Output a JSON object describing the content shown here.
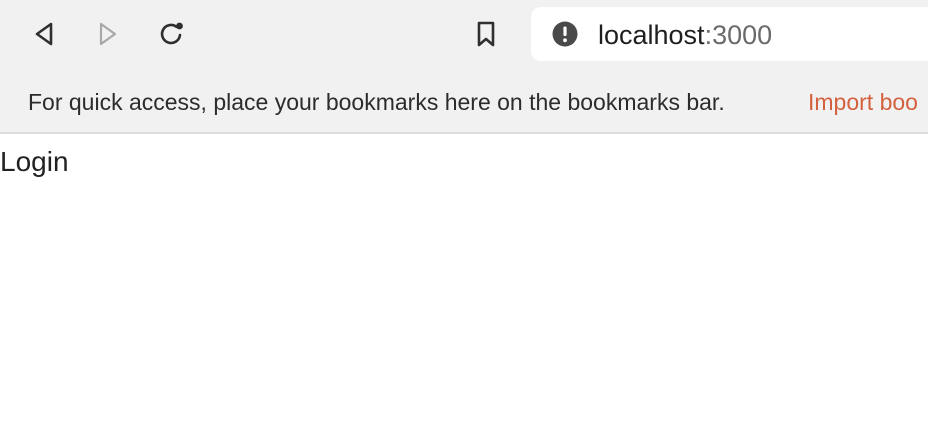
{
  "browser": {
    "address_bar": {
      "host": "localhost",
      "port": ":3000"
    },
    "bookmarks_bar": {
      "message": "For quick access, place your bookmarks here on the bookmarks bar.",
      "import_link": "Import boo"
    }
  },
  "page": {
    "heading": "Login"
  },
  "icons": {
    "back": "back-arrow-icon",
    "forward": "forward-arrow-icon",
    "reload": "reload-icon",
    "bookmark": "bookmark-icon",
    "site_info": "info-warning-icon"
  },
  "colors": {
    "link": "#d4603f",
    "chrome_background": "#f1f1f1"
  }
}
